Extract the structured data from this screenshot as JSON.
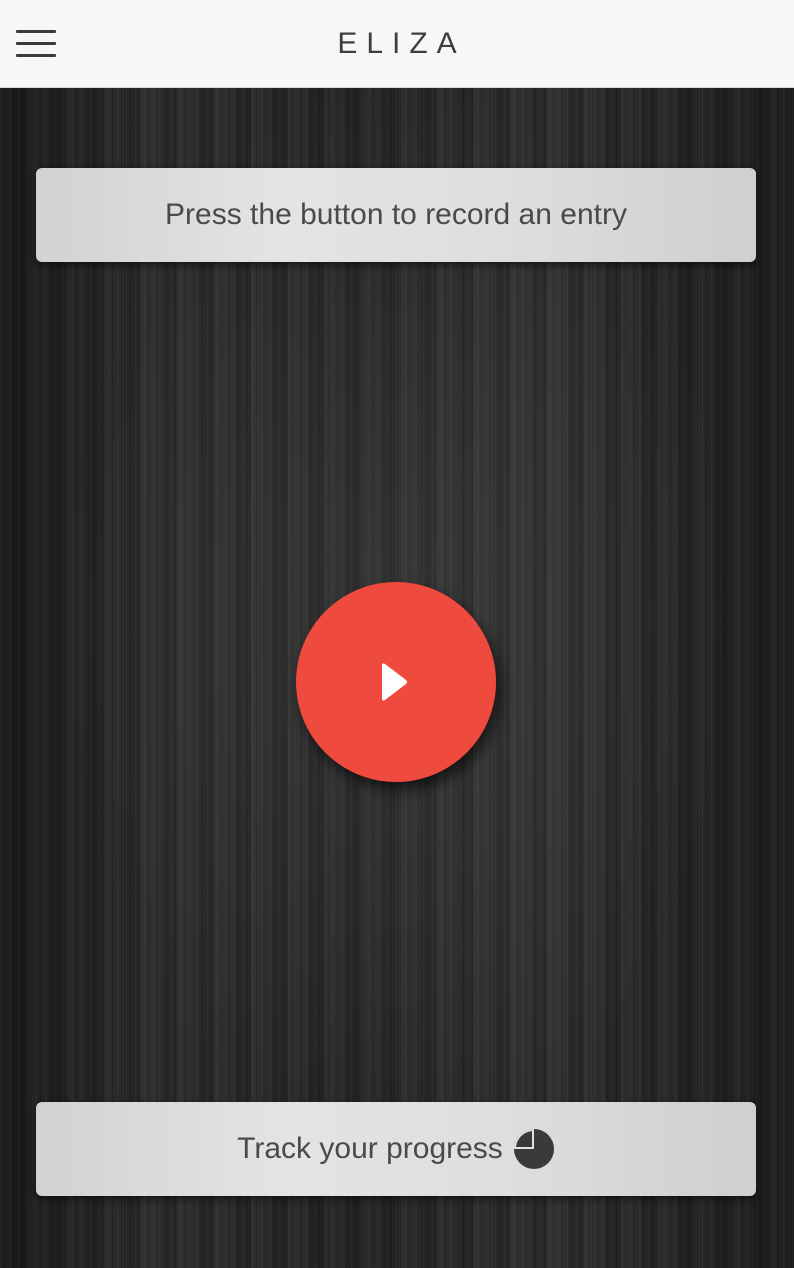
{
  "header": {
    "title": "ELIZA",
    "menu_icon": "hamburger-menu-icon"
  },
  "prompt": {
    "text": "Press the button to record an entry"
  },
  "record_button": {
    "icon": "play-icon",
    "color": "#ef4a3e"
  },
  "progress": {
    "label": "Track your progress",
    "icon": "pie-chart-icon"
  },
  "colors": {
    "header_bg": "#f7f7f7",
    "accent": "#ef4a3e",
    "card_text": "#4a4a4a"
  }
}
